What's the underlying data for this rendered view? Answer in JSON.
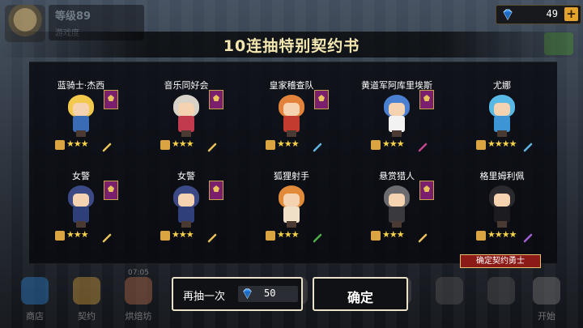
{
  "player": {
    "level_label": "等级89",
    "sub_label": "游戏度"
  },
  "gems": {
    "count": "49",
    "plus": "+",
    "color": "#2f8df0"
  },
  "title": "10连抽特别契约书",
  "heroes": [
    {
      "name": "蓝骑士·杰西",
      "stars": "★★★",
      "hair": "#f2c94c",
      "outfit": "#3a6bb5",
      "weapon": "#e8c25a",
      "banner": true
    },
    {
      "name": "音乐同好会",
      "stars": "★★★",
      "hair": "#d9d2c8",
      "outfit": "#c23b4c",
      "weapon": "#e8c25a",
      "banner": true
    },
    {
      "name": "皇家稽查队",
      "stars": "★★★",
      "hair": "#e3823a",
      "outfit": "#c23b2e",
      "weapon": "#5fb6e0",
      "banner": true
    },
    {
      "name": "黄道军阿库里埃斯",
      "stars": "★★★",
      "hair": "#4a7fd1",
      "outfit": "#f2f2f2",
      "weapon": "#c2458f",
      "banner": true
    },
    {
      "name": "尤娜",
      "stars": "★★★★",
      "hair": "#58b8e6",
      "outfit": "#3c96d6",
      "weapon": "#5fb6e0",
      "banner": false
    },
    {
      "name": "女警",
      "stars": "★★★",
      "hair": "#3b4a86",
      "outfit": "#2f3f7a",
      "weapon": "#e8c25a",
      "banner": true
    },
    {
      "name": "女警",
      "stars": "★★★",
      "hair": "#3b4a86",
      "outfit": "#2f3f7a",
      "weapon": "#e8c25a",
      "banner": true
    },
    {
      "name": "狐狸射手",
      "stars": "★★★",
      "hair": "#e08a3a",
      "outfit": "#f0e0c8",
      "weapon": "#4fb04a",
      "banner": false
    },
    {
      "name": "悬赏猎人",
      "stars": "★★★",
      "hair": "#6c6c70",
      "outfit": "#3a3a3e",
      "weapon": "#e8c25a",
      "banner": true
    },
    {
      "name": "格里姆利佩",
      "stars": "★★★★",
      "hair": "#2a2a2e",
      "outfit": "#1c1c20",
      "weapon": "#a35fd6",
      "banner": false
    }
  ],
  "buttons": {
    "summon_again": "再抽一次",
    "summon_price": "50",
    "confirm": "确定",
    "confirm_hero_tag": "确定契约勇士"
  },
  "nav": [
    {
      "label": "商店",
      "top": "",
      "color": "#2d7fc7"
    },
    {
      "label": "契约",
      "top": "",
      "color": "#c99a3a"
    },
    {
      "label": "烘焙坊",
      "top": "07:05",
      "color": "#b06a4a"
    },
    {
      "label": "",
      "top": "",
      "color": "#555"
    },
    {
      "label": "",
      "top": "",
      "color": "#555"
    },
    {
      "label": "",
      "top": "",
      "color": "#555"
    },
    {
      "label": "",
      "top": "",
      "color": "#555"
    },
    {
      "label": "",
      "top": "",
      "color": "#555"
    },
    {
      "label": "",
      "top": "",
      "color": "#555"
    },
    {
      "label": "",
      "top": "",
      "color": "#555"
    },
    {
      "label": "开始",
      "top": "",
      "color": "#777"
    }
  ]
}
